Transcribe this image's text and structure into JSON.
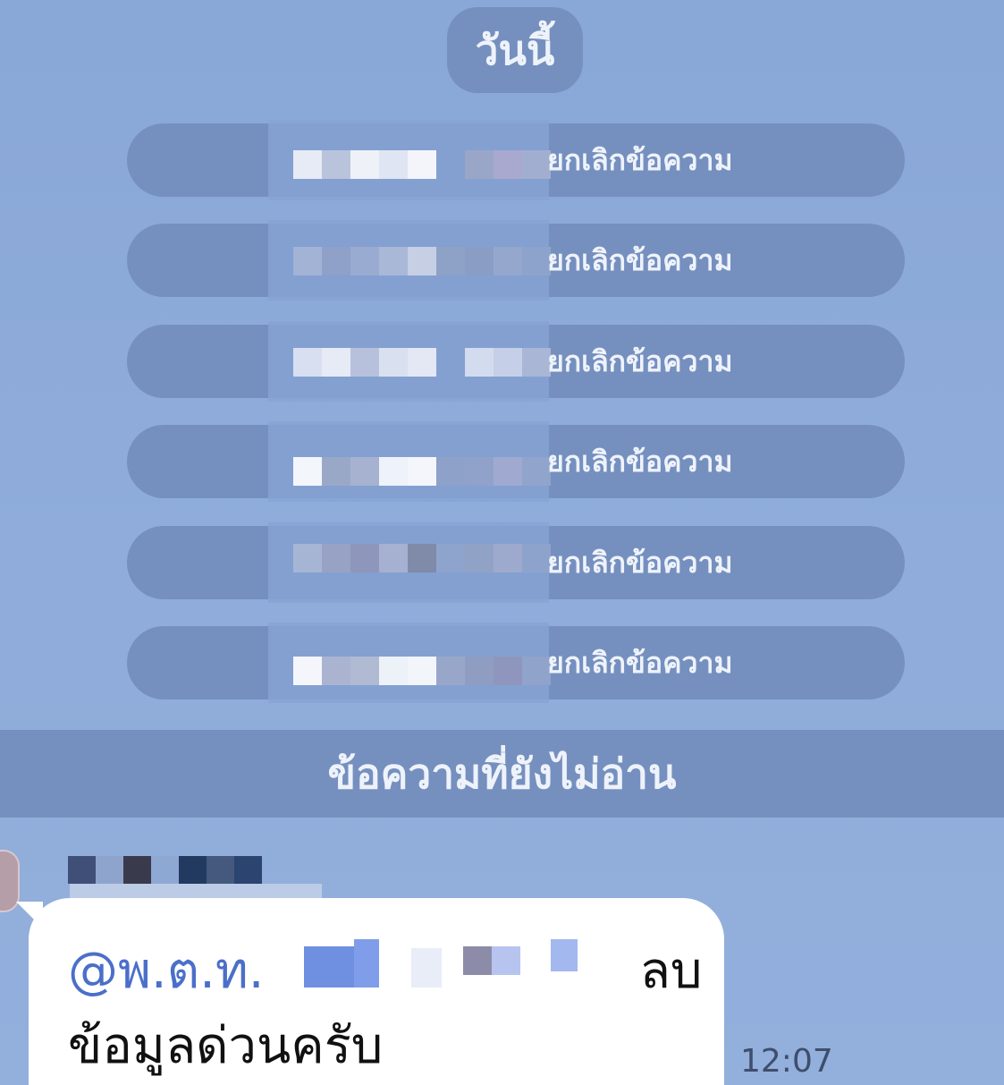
{
  "chat": {
    "date_label": "วันนี้",
    "unsend_notices": [
      {
        "text": "ยกเลิกข้อความ"
      },
      {
        "text": "ยกเลิกข้อความ"
      },
      {
        "text": "ยกเลิกข้อความ"
      },
      {
        "text": "ยกเลิกข้อความ"
      },
      {
        "text": "ยกเลิกข้อความ"
      },
      {
        "text": "ยกเลิกข้อความ"
      }
    ],
    "unread_divider": "ข้อความที่ยังไม่อ่าน",
    "message": {
      "mention": "@พ.ต.ท.",
      "text_after_mention": "ลบ",
      "line2": "ข้อมูลด่วนครับ",
      "time": "12:07"
    }
  },
  "colors": {
    "background": "#8aa8d8",
    "system_pill": "#7590bf",
    "bubble": "#ffffff",
    "mention": "#4b6fc9"
  }
}
